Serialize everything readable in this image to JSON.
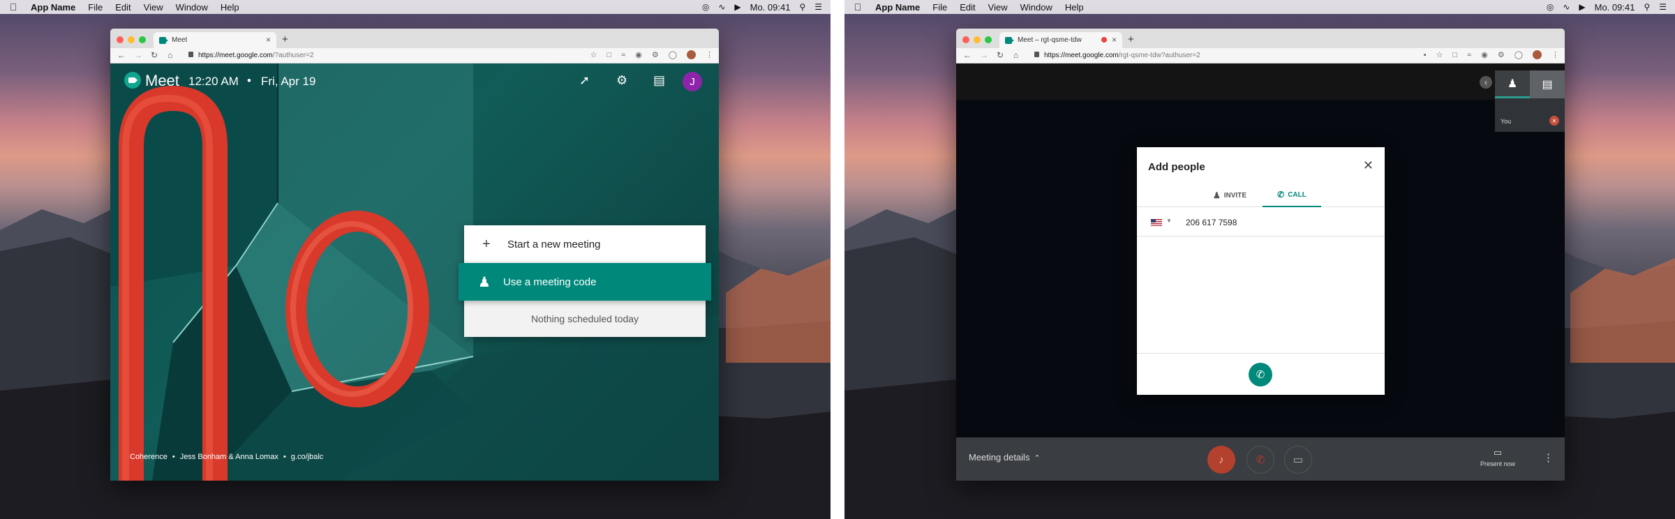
{
  "desktop": {
    "menubar": {
      "apple_icon": "apple-logo-icon",
      "app_name": "App Name",
      "items": [
        "File",
        "Edit",
        "View",
        "Window",
        "Help"
      ],
      "clock": "Mo. 09:41",
      "status_icons": [
        "airdrop-icon",
        "wifi-icon",
        "volume-icon",
        "search-icon",
        "list-icon"
      ]
    }
  },
  "left_browser": {
    "tab_title": "Meet",
    "url_host": "https://meet.google.com",
    "url_path": "/?authuser=2",
    "meet": {
      "logo_text": "Meet",
      "time": "12:20 AM",
      "separator": "•",
      "date": "Fri, Apr 19",
      "avatar_initial": "J",
      "header_icons": [
        "trending-icon",
        "gear-icon",
        "feedback-icon"
      ]
    },
    "card": {
      "start_label": "Start a new meeting",
      "code_label": "Use a meeting code",
      "note": "Nothing scheduled today"
    },
    "credits": {
      "title": "Coherence",
      "artists": "Jess Bonham & Anna Lomax",
      "link": "g.co/jbalc",
      "dot": "•"
    }
  },
  "right_browser": {
    "tab_title": "Meet – rgt-qsme-tdw",
    "url_host": "https://meet.google.com",
    "url_path": "/rgt-qsme-tdw?authuser=2",
    "self_label": "You",
    "dialog": {
      "title": "Add people",
      "tab_invite": "INVITE",
      "tab_call": "CALL",
      "phone_number": "206 617 7598"
    },
    "bottom": {
      "meeting_details": "Meeting details",
      "present_now": "Present now"
    }
  },
  "colors": {
    "meet_teal": "#00897b",
    "avatar_purple": "#8e24aa",
    "mic_off_red": "#b4412d"
  }
}
